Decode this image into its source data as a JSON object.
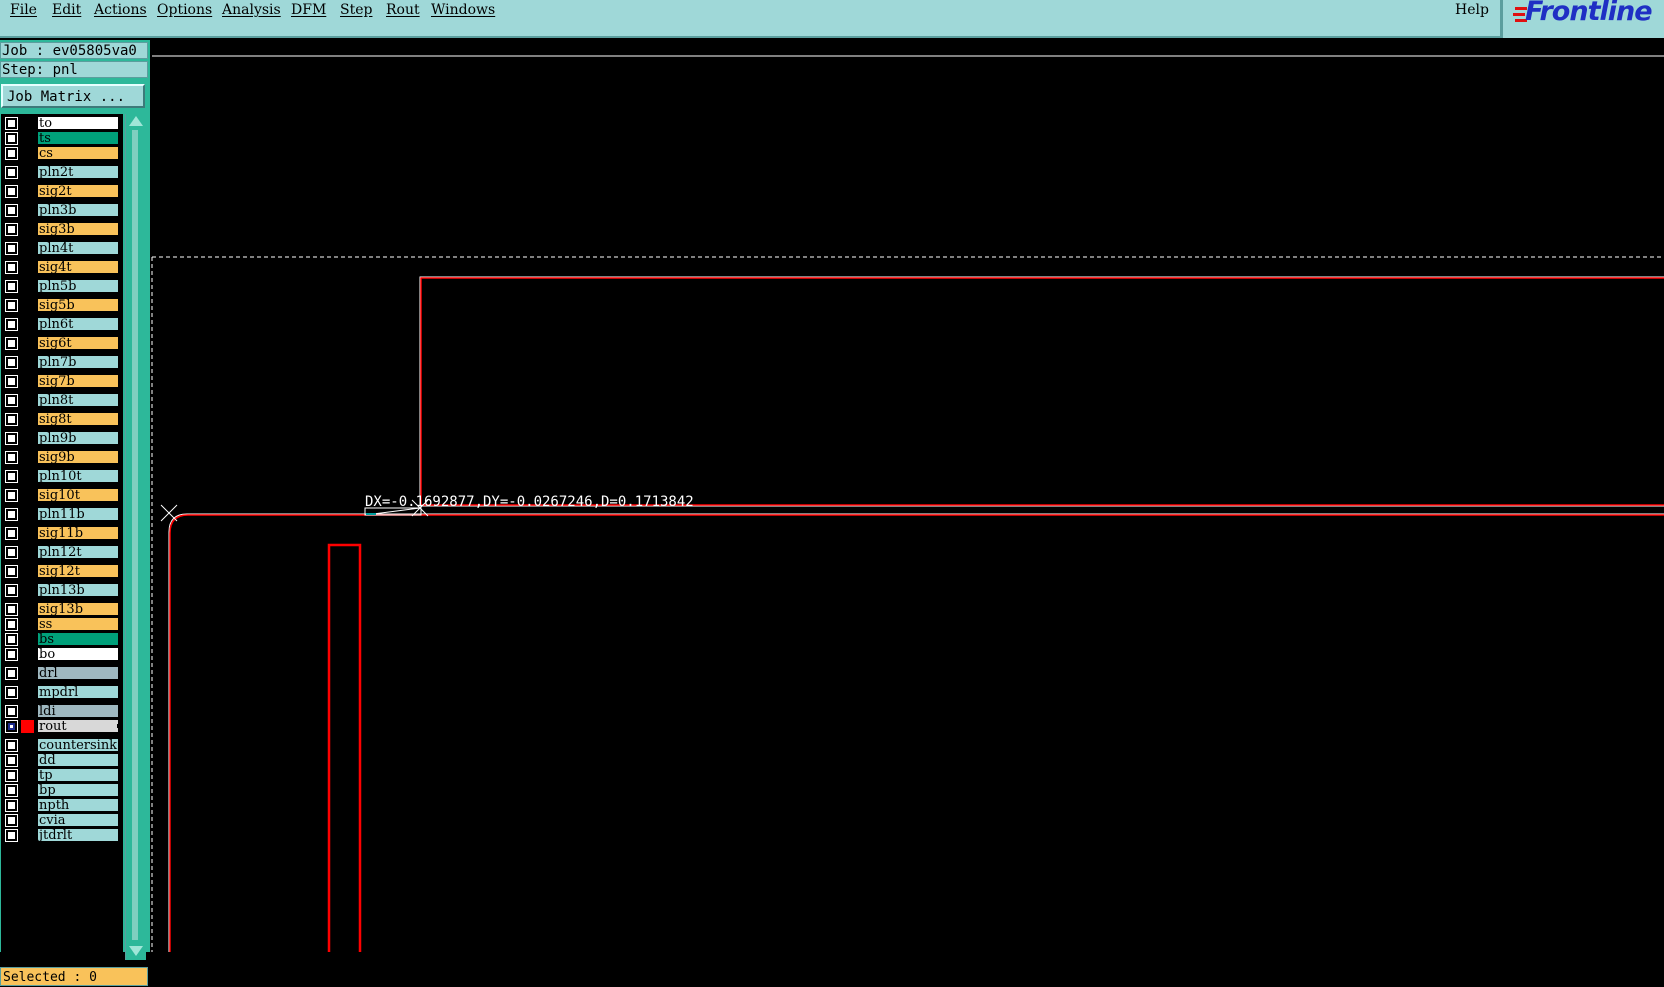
{
  "menu": {
    "items": [
      "File",
      "Edit",
      "Actions",
      "Options",
      "Analysis",
      "DFM",
      "Step",
      "Rout",
      "Windows"
    ],
    "help": "Help",
    "logo": "Frontline"
  },
  "job": {
    "job_label": "Job : ev05805va0",
    "step_label": "Step: pnl"
  },
  "job_matrix_button": "Job Matrix ...",
  "layers": [
    {
      "name": "to",
      "color": "#ffffff",
      "swatch": "#000000",
      "checked": false
    },
    {
      "name": "ts",
      "color": "#00a07a",
      "swatch": "#000000",
      "checked": false
    },
    {
      "name": "cs",
      "color": "#f9c25a",
      "swatch": "#000000",
      "checked": false
    },
    {
      "name": "pln2t",
      "color": "#9fd8d8",
      "swatch": "#000000",
      "checked": false
    },
    {
      "name": "sig2t",
      "color": "#f9c25a",
      "swatch": "#000000",
      "checked": false
    },
    {
      "name": "pln3b",
      "color": "#9fd8d8",
      "swatch": "#000000",
      "checked": false
    },
    {
      "name": "sig3b",
      "color": "#f9c25a",
      "swatch": "#000000",
      "checked": false
    },
    {
      "name": "pln4t",
      "color": "#9fd8d8",
      "swatch": "#000000",
      "checked": false
    },
    {
      "name": "sig4t",
      "color": "#f9c25a",
      "swatch": "#000000",
      "checked": false
    },
    {
      "name": "pln5b",
      "color": "#9fd8d8",
      "swatch": "#000000",
      "checked": false
    },
    {
      "name": "sig5b",
      "color": "#f9c25a",
      "swatch": "#000000",
      "checked": false
    },
    {
      "name": "pln6t",
      "color": "#9fd8d8",
      "swatch": "#000000",
      "checked": false
    },
    {
      "name": "sig6t",
      "color": "#f9c25a",
      "swatch": "#000000",
      "checked": false
    },
    {
      "name": "pln7b",
      "color": "#9fd8d8",
      "swatch": "#000000",
      "checked": false
    },
    {
      "name": "sig7b",
      "color": "#f9c25a",
      "swatch": "#000000",
      "checked": false
    },
    {
      "name": "pln8t",
      "color": "#9fd8d8",
      "swatch": "#000000",
      "checked": false
    },
    {
      "name": "sig8t",
      "color": "#f9c25a",
      "swatch": "#000000",
      "checked": false
    },
    {
      "name": "pln9b",
      "color": "#9fd8d8",
      "swatch": "#000000",
      "checked": false
    },
    {
      "name": "sig9b",
      "color": "#f9c25a",
      "swatch": "#000000",
      "checked": false
    },
    {
      "name": "pln10t",
      "color": "#9fd8d8",
      "swatch": "#000000",
      "checked": false
    },
    {
      "name": "sig10t",
      "color": "#f9c25a",
      "swatch": "#000000",
      "checked": false
    },
    {
      "name": "pln11b",
      "color": "#9fd8d8",
      "swatch": "#000000",
      "checked": false
    },
    {
      "name": "sig11b",
      "color": "#f9c25a",
      "swatch": "#000000",
      "checked": false
    },
    {
      "name": "pln12t",
      "color": "#9fd8d8",
      "swatch": "#000000",
      "checked": false
    },
    {
      "name": "sig12t",
      "color": "#f9c25a",
      "swatch": "#000000",
      "checked": false
    },
    {
      "name": "pln13b",
      "color": "#9fd8d8",
      "swatch": "#000000",
      "checked": false
    },
    {
      "name": "sig13b",
      "color": "#f9c25a",
      "swatch": "#000000",
      "checked": false
    },
    {
      "name": "ss",
      "color": "#f9c25a",
      "swatch": "#000000",
      "checked": false
    },
    {
      "name": "bs",
      "color": "#00a07a",
      "swatch": "#000000",
      "checked": false
    },
    {
      "name": "bo",
      "color": "#ffffff",
      "swatch": "#000000",
      "checked": false
    },
    {
      "name": "drl",
      "color": "#9fb8c0",
      "swatch": "#000000",
      "checked": false
    },
    {
      "name": "mpdrl",
      "color": "#9fd8d8",
      "swatch": "#000000",
      "checked": false
    },
    {
      "name": "ldi",
      "color": "#9fb8c0",
      "swatch": "#000000",
      "checked": false
    },
    {
      "name": "rout",
      "color": "#d8d8d8",
      "swatch": "#ff0000",
      "checked": true
    },
    {
      "name": "countersink",
      "color": "#9fd8d8",
      "swatch": "#000000",
      "checked": false
    },
    {
      "name": "dd",
      "color": "#9fd8d8",
      "swatch": "#000000",
      "checked": false
    },
    {
      "name": "tp",
      "color": "#9fd8d8",
      "swatch": "#000000",
      "checked": false
    },
    {
      "name": "bp",
      "color": "#9fd8d8",
      "swatch": "#000000",
      "checked": false
    },
    {
      "name": "npth",
      "color": "#9fd8d8",
      "swatch": "#000000",
      "checked": false
    },
    {
      "name": "cvia",
      "color": "#9fd8d8",
      "swatch": "#000000",
      "checked": false
    },
    {
      "name": "jtdrlt",
      "color": "#9fd8d8",
      "swatch": "#000000",
      "checked": false
    }
  ],
  "selected_label": "Selected : 0",
  "measurement": "DX=-0.1692877,DY=-0.0267246,D=0.1713842",
  "colors": {
    "menu_bg": "#9fd8d8",
    "sidebar_bg": "#2db89a",
    "rout_line": "#ff0000",
    "logo": "#1f2fc4"
  }
}
